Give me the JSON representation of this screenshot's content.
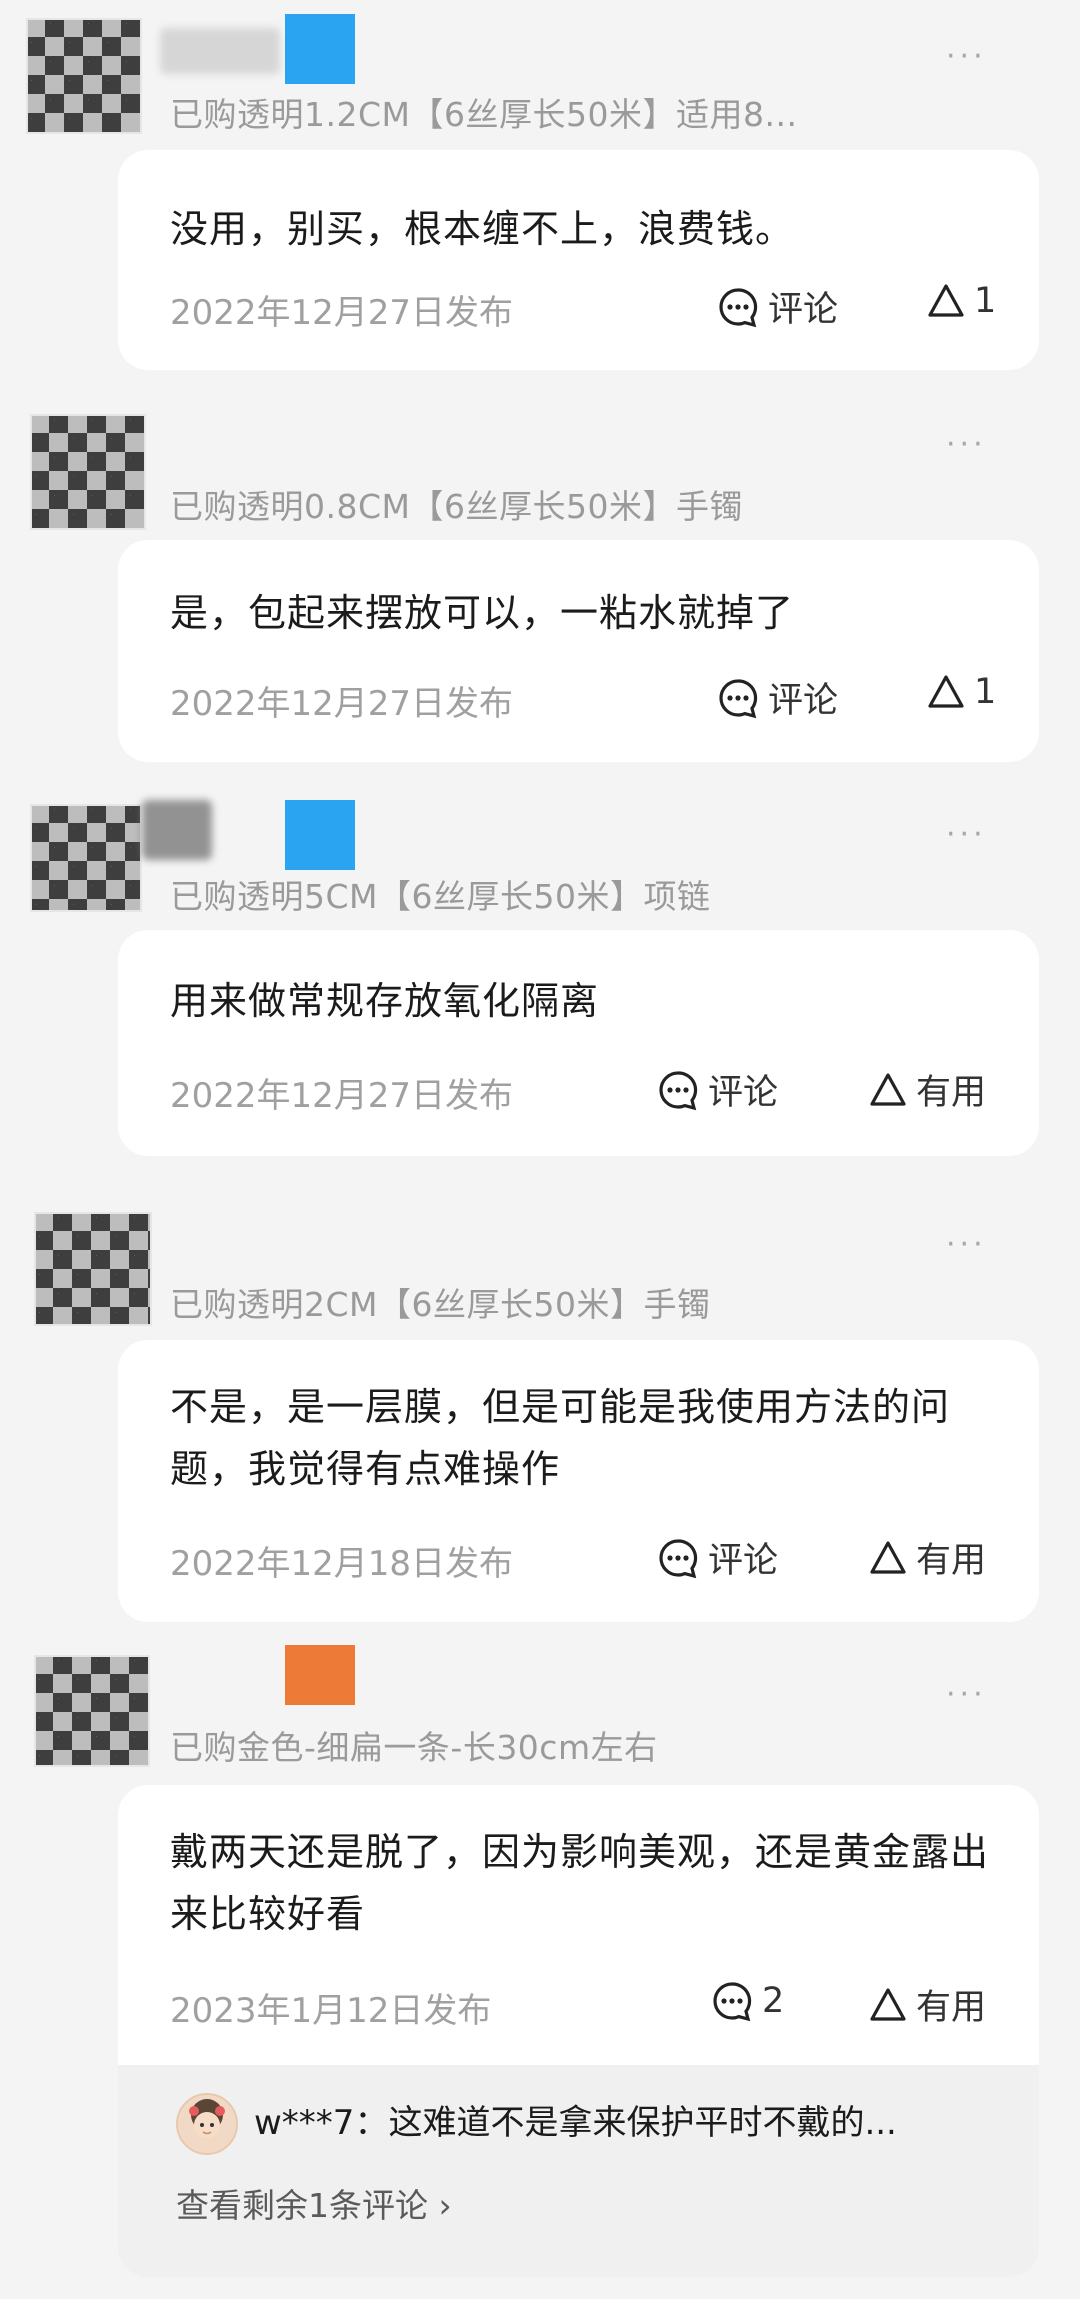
{
  "reviews": [
    {
      "spec": "已购透明1.2CM【6丝厚长50米】适用8...",
      "text": "没用，别买，根本缠不上，浪费钱。",
      "date": "2022年12月27日发布",
      "comment_label": "评论",
      "like_label": "1",
      "tag_color": "#2aa3f0"
    },
    {
      "spec": "已购透明0.8CM【6丝厚长50米】手镯",
      "text": "是，包起来摆放可以，一粘水就掉了",
      "date": "2022年12月27日发布",
      "comment_label": "评论",
      "like_label": "1"
    },
    {
      "spec": "已购透明5CM【6丝厚长50米】项链",
      "text": "用来做常规存放氧化隔离",
      "date": "2022年12月27日发布",
      "comment_label": "评论",
      "like_label": "有用",
      "tag_color": "#2aa3f0"
    },
    {
      "spec": "已购透明2CM【6丝厚长50米】手镯",
      "text": "不是，是一层膜，但是可能是我使用方法的问题，我觉得有点难操作",
      "date": "2022年12月18日发布",
      "comment_label": "评论",
      "like_label": "有用"
    },
    {
      "spec": "已购金色-细扁一条-长30cm左右",
      "text": "戴两天还是脱了，因为影响美观，还是黄金露出来比较好看",
      "date": "2023年1月12日发布",
      "comment_label": "2",
      "like_label": "有用",
      "tag_color": "#ee7a38",
      "reply": {
        "text": "w***7：这难道不是拿来保护平时不戴的...",
        "more_label": "查看剩余1条评论 ›"
      }
    }
  ],
  "more_icon": "···",
  "icons": {
    "comment": "comment-icon",
    "like": "like-triangle-icon",
    "more": "more-dots-icon"
  }
}
